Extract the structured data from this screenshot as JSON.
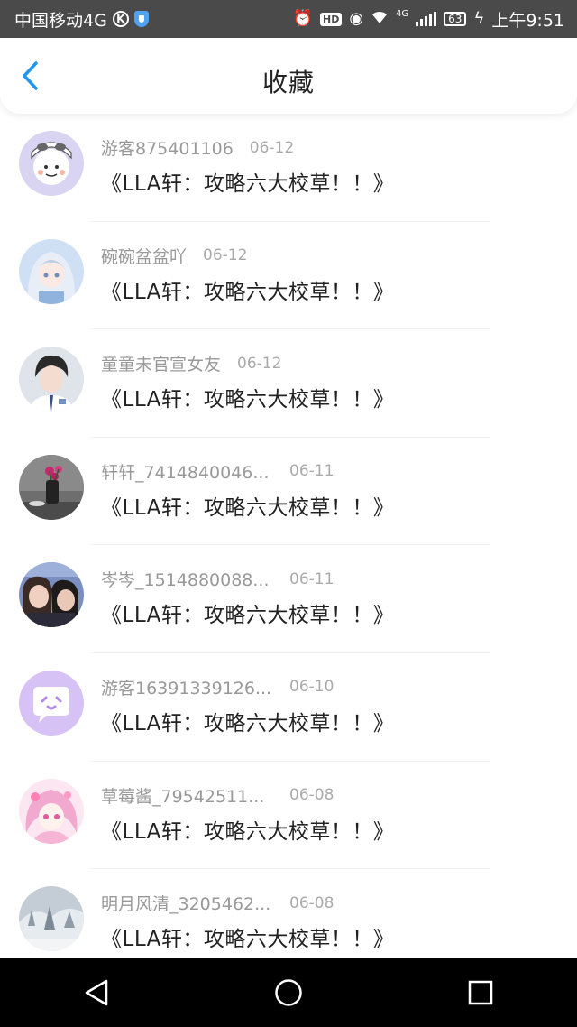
{
  "status_bar": {
    "carrier": "中国移动4G",
    "k_badge": "K",
    "hd": "HD",
    "net": "4G",
    "battery": "63",
    "time": "上午9:51"
  },
  "header": {
    "title": "收藏"
  },
  "items": [
    {
      "user": "游客875401106",
      "date": "06-12",
      "title": "《LLA轩：攻略六大校草！！》"
    },
    {
      "user": "碗碗盆盆吖",
      "date": "06-12",
      "title": "《LLA轩：攻略六大校草！！》"
    },
    {
      "user": "童童未官宣女友",
      "date": "06-12",
      "title": "《LLA轩：攻略六大校草！！》"
    },
    {
      "user": "轩轩_7414840046...",
      "date": "06-11",
      "title": "《LLA轩：攻略六大校草！！》"
    },
    {
      "user": "岑岑_1514880088...",
      "date": "06-11",
      "title": "《LLA轩：攻略六大校草！！》"
    },
    {
      "user": "游客16391339126...",
      "date": "06-10",
      "title": "《LLA轩：攻略六大校草！！》"
    },
    {
      "user": "草莓酱_79542511...",
      "date": "06-08",
      "title": "《LLA轩：攻略六大校草！！》"
    },
    {
      "user": "明月风清_3205462...",
      "date": "06-08",
      "title": "《LLA轩：攻略六大校草！！》"
    }
  ],
  "colors": {
    "accent": "#2196f3",
    "statusbar": "#4a4a4a",
    "navbar": "#000000"
  }
}
